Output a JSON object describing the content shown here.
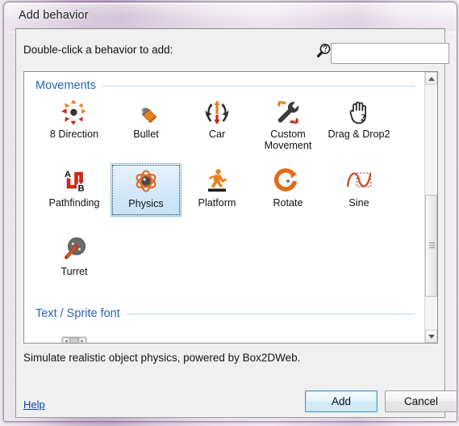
{
  "window": {
    "title": "Add behavior"
  },
  "prompt": {
    "label": "Double-click a behavior to add:"
  },
  "search": {
    "value": "",
    "placeholder": "",
    "icon": "search-help-icon"
  },
  "sections": [
    {
      "title": "Movements"
    },
    {
      "title": "Text / Sprite font"
    }
  ],
  "behaviors": [
    {
      "name": "8 Direction",
      "icon": "eight-direction-icon",
      "selected": false
    },
    {
      "name": "Bullet",
      "icon": "bullet-icon",
      "selected": false
    },
    {
      "name": "Car",
      "icon": "car-icon",
      "selected": false
    },
    {
      "name": "Custom Movement",
      "icon": "wrench-icon",
      "selected": false
    },
    {
      "name": "Drag & Drop2",
      "icon": "hand-drag-icon",
      "selected": false
    },
    {
      "name": "Pathfinding",
      "icon": "pathfinding-icon",
      "selected": false
    },
    {
      "name": "Physics",
      "icon": "physics-atom-icon",
      "selected": true
    },
    {
      "name": "Platform",
      "icon": "platform-runner-icon",
      "selected": false
    },
    {
      "name": "Rotate",
      "icon": "rotate-icon",
      "selected": false
    },
    {
      "name": "Sine",
      "icon": "sine-wave-icon",
      "selected": false
    },
    {
      "name": "Turret",
      "icon": "turret-icon",
      "selected": false
    }
  ],
  "description": {
    "text": "Simulate realistic object physics, powered by Box2DWeb."
  },
  "footer": {
    "help_label": "Help",
    "add_label": "Add",
    "cancel_label": "Cancel"
  },
  "colors": {
    "accent_blue": "#2b63b5",
    "selection_fill": "#d3e8f9",
    "selection_border": "#8fc4e8",
    "default_button_border": "#3c9ad6",
    "link": "#0b44b0",
    "icon_orange": "#e8821e",
    "icon_red": "#cc2b16",
    "icon_dark": "#3a3a3a"
  }
}
